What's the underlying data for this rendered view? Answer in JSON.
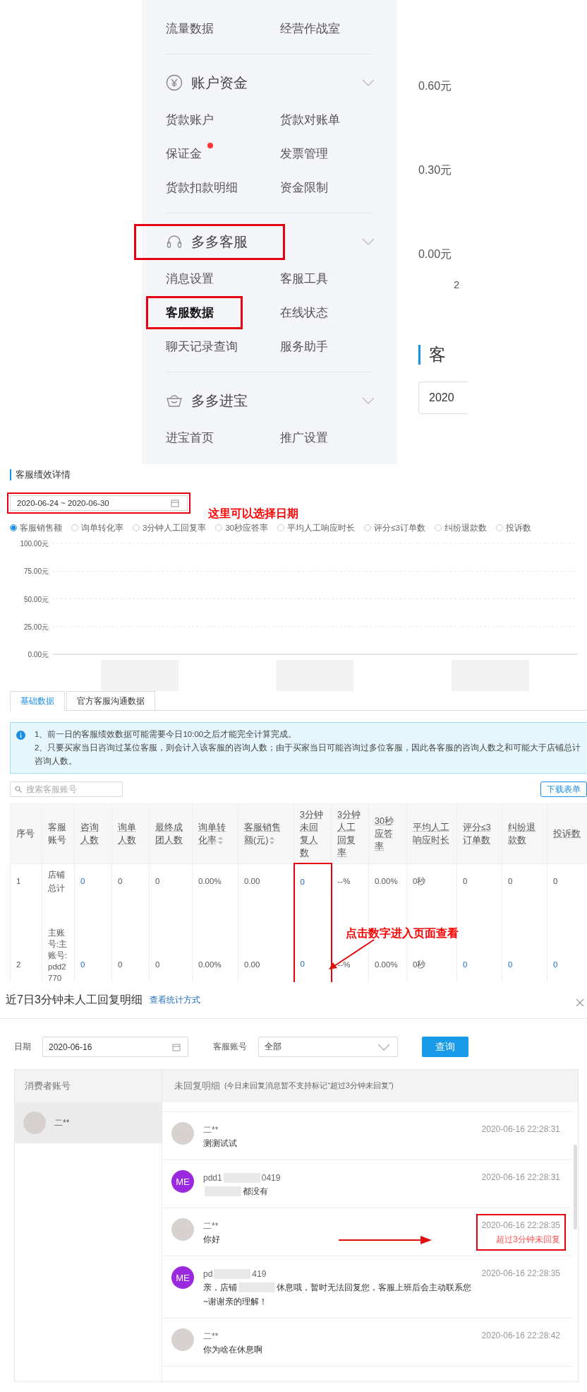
{
  "sidebar": {
    "groups": [
      {
        "items": [
          {
            "label": "流量数据",
            "active": false,
            "highlighted": false,
            "dot": false
          },
          {
            "label": "经营作战室",
            "active": false,
            "highlighted": false,
            "dot": false
          }
        ]
      },
      {
        "title": "账户资金",
        "highlighted": false,
        "items": [
          {
            "label": "货款账户",
            "active": false,
            "highlighted": false,
            "dot": false
          },
          {
            "label": "货款对账单",
            "active": false,
            "highlighted": false,
            "dot": false
          },
          {
            "label": "保证金",
            "active": false,
            "highlighted": false,
            "dot": true
          },
          {
            "label": "发票管理",
            "active": false,
            "highlighted": false,
            "dot": false
          },
          {
            "label": "货款扣款明细",
            "active": false,
            "highlighted": false,
            "dot": false
          },
          {
            "label": "资金限制",
            "active": false,
            "highlighted": false,
            "dot": false
          }
        ]
      },
      {
        "title": "多多客服",
        "highlighted": true,
        "items": [
          {
            "label": "消息设置",
            "active": false,
            "highlighted": false,
            "dot": false
          },
          {
            "label": "客服工具",
            "active": false,
            "highlighted": false,
            "dot": false
          },
          {
            "label": "客服数据",
            "active": true,
            "highlighted": true,
            "dot": false
          },
          {
            "label": "在线状态",
            "active": false,
            "highlighted": false,
            "dot": false
          },
          {
            "label": "聊天记录查询",
            "active": false,
            "highlighted": false,
            "dot": false
          },
          {
            "label": "服务助手",
            "active": false,
            "highlighted": false,
            "dot": false
          }
        ]
      },
      {
        "title": "多多进宝",
        "highlighted": false,
        "items": [
          {
            "label": "进宝首页",
            "active": false,
            "highlighted": false,
            "dot": false
          },
          {
            "label": "推广设置",
            "active": false,
            "highlighted": false,
            "dot": false
          }
        ]
      }
    ]
  },
  "chart_strip": {
    "axis_labels": [
      "0.60元",
      "0.30元",
      "0.00元"
    ],
    "tick_fragment": "2",
    "section_title": "客",
    "date_value": "2020"
  },
  "performance": {
    "title": "客服绩效详情",
    "date_range": {
      "value": "2020-06-24 ~ 2020-06-30",
      "highlighted": true
    },
    "annotation": "这里可以选择日期",
    "metrics": [
      {
        "label": "客服销售额",
        "selected": true
      },
      {
        "label": "询单转化率",
        "selected": false
      },
      {
        "label": "3分钟人工回复率",
        "selected": false
      },
      {
        "label": "30秒应答率",
        "selected": false
      },
      {
        "label": "平均人工响应时长",
        "selected": false
      },
      {
        "label": "评分≤3订单数",
        "selected": false
      },
      {
        "label": "纠纷退款数",
        "selected": false
      },
      {
        "label": "投诉数",
        "selected": false
      }
    ],
    "chart_data": {
      "type": "line",
      "grid": true,
      "categories": [
        null,
        null,
        null
      ],
      "ylim": [
        0,
        100
      ],
      "yticks": [
        {
          "value": 0,
          "label": "0.00元"
        },
        {
          "value": 25,
          "label": "25.00元"
        },
        {
          "value": 50,
          "label": "50.00元"
        },
        {
          "value": 75,
          "label": "75.00元"
        },
        {
          "value": 100,
          "label": "100.00元"
        }
      ]
    },
    "tabs": [
      {
        "label": "基础数据",
        "selected": true
      },
      {
        "label": "官方客服沟通数据",
        "selected": false
      }
    ],
    "notices": [
      "1、前一日的客服绩效数据可能需要今日10:00之后才能完全计算完成。",
      "2、只要买家当日咨询过某位客服，则会计入该客服的咨询人数；由于买家当日可能咨询过多位客服，因此各客服的咨询人数之和可能大于店铺总计咨询人数。"
    ],
    "search": {
      "placeholder": "搜索客服账号"
    },
    "download_button": "下载表单",
    "table": {
      "columns": [
        {
          "label": "序号",
          "underlined": false,
          "sortable": false,
          "highlighted": false
        },
        {
          "label": "客服账号",
          "underlined": false,
          "sortable": false,
          "highlighted": false
        },
        {
          "label": "咨询人数",
          "underlined": true,
          "sortable": false,
          "highlighted": false
        },
        {
          "label": "询单人数",
          "underlined": true,
          "sortable": false,
          "highlighted": false
        },
        {
          "label": "最终成团人数",
          "underlined": true,
          "sortable": false,
          "highlighted": false
        },
        {
          "label": "询单转化率",
          "underlined": true,
          "sortable": true,
          "highlighted": false
        },
        {
          "label": "客服销售额(元)",
          "underlined": true,
          "sortable": true,
          "highlighted": false
        },
        {
          "label": "3分钟未回复人数",
          "underlined": true,
          "sortable": false,
          "highlighted": true
        },
        {
          "label": "3分钟人工回复率",
          "underlined": true,
          "sortable": false,
          "highlighted": false
        },
        {
          "label": "30秒应答率",
          "underlined": true,
          "sortable": false,
          "highlighted": false
        },
        {
          "label": "平均人工响应时长",
          "underlined": true,
          "sortable": false,
          "highlighted": false
        },
        {
          "label": "评分≤3订单数",
          "underlined": true,
          "sortable": false,
          "highlighted": false
        },
        {
          "label": "纠纷退款数",
          "underlined": true,
          "sortable": false,
          "highlighted": false
        },
        {
          "label": "投诉数",
          "underlined": true,
          "sortable": false,
          "highlighted": false
        }
      ],
      "rows": [
        {
          "cells": [
            {
              "text": "1",
              "link": false
            },
            {
              "text": "店铺总计",
              "link": false
            },
            {
              "text": "0",
              "link": true
            },
            {
              "text": "0",
              "link": false
            },
            {
              "text": "0",
              "link": false
            },
            {
              "text": "0.00%",
              "link": false
            },
            {
              "text": "0.00",
              "link": false
            },
            {
              "text": "0",
              "link": true
            },
            {
              "text": "--%",
              "link": false
            },
            {
              "text": "0.00%",
              "link": false
            },
            {
              "text": "0秒",
              "link": false
            },
            {
              "text": "0",
              "link": false
            },
            {
              "text": "0",
              "link": false
            },
            {
              "text": "0",
              "link": false
            }
          ]
        },
        {
          "cells": [
            {
              "text": "2",
              "link": false
            },
            {
              "text": "主账号:主账号:pdd2770",
              "link": false
            },
            {
              "text": "0",
              "link": true
            },
            {
              "text": "0",
              "link": false
            },
            {
              "text": "0",
              "link": false
            },
            {
              "text": "0.00%",
              "link": false
            },
            {
              "text": "0.00",
              "link": false
            },
            {
              "text": "0",
              "link": true
            },
            {
              "text": "--%",
              "link": false
            },
            {
              "text": "0.00%",
              "link": false
            },
            {
              "text": "0秒",
              "link": false
            },
            {
              "text": "0",
              "link": true
            },
            {
              "text": "0",
              "link": true
            },
            {
              "text": "0",
              "link": true
            }
          ]
        }
      ]
    },
    "table_annotation": "点击数字进入页面查看"
  },
  "modal": {
    "title": "近7日3分钟未人工回复明细",
    "help_link": "查看统计方式",
    "filters": {
      "date_label": "日期",
      "date_value": "2020-06-16",
      "account_label": "客服账号",
      "account_value": "全部",
      "query_button": "查询"
    },
    "consumer_header": "消费者账号",
    "consumers": [
      {
        "name": "二**",
        "selected": true
      }
    ],
    "detail_header": "未回复明细",
    "detail_note": "(今日未回复消息暂不支持标记“超过3分钟未回复”)",
    "messages": [
      {
        "kind": "consumer",
        "sender": [
          "二**"
        ],
        "text": [
          [
            "测测试试"
          ]
        ],
        "text_blur_start": false,
        "time": "2020-06-16 22:28:31",
        "highlighted": false
      },
      {
        "kind": "staff",
        "avatar_text": "ME",
        "sender": [
          "pdd1",
          "0419"
        ],
        "text": [
          [
            "都没有"
          ]
        ],
        "text_blur_start": true,
        "time": "2020-06-16 22:28:31",
        "highlighted": false
      },
      {
        "kind": "consumer",
        "sender": [
          "二**"
        ],
        "text": [
          [
            "你好"
          ]
        ],
        "text_blur_start": false,
        "time": "2020-06-16 22:28:35",
        "flag": "超过3分钟未回复",
        "highlighted": true
      },
      {
        "kind": "staff",
        "avatar_text": "ME",
        "sender": [
          "pd",
          "419"
        ],
        "text": [
          [
            "亲，店铺",
            "休息哦，暂时无法回复您，客服上班后会主动联系您"
          ],
          [
            "~谢谢亲的理解！"
          ]
        ],
        "text_blur_start": false,
        "time": "2020-06-16 22:28:35",
        "highlighted": false
      },
      {
        "kind": "consumer",
        "sender": [
          "二**"
        ],
        "text": [
          [
            "你为啥在休息啊"
          ]
        ],
        "text_blur_start": false,
        "time": "2020-06-16 22:28:42",
        "highlighted": false
      }
    ]
  }
}
